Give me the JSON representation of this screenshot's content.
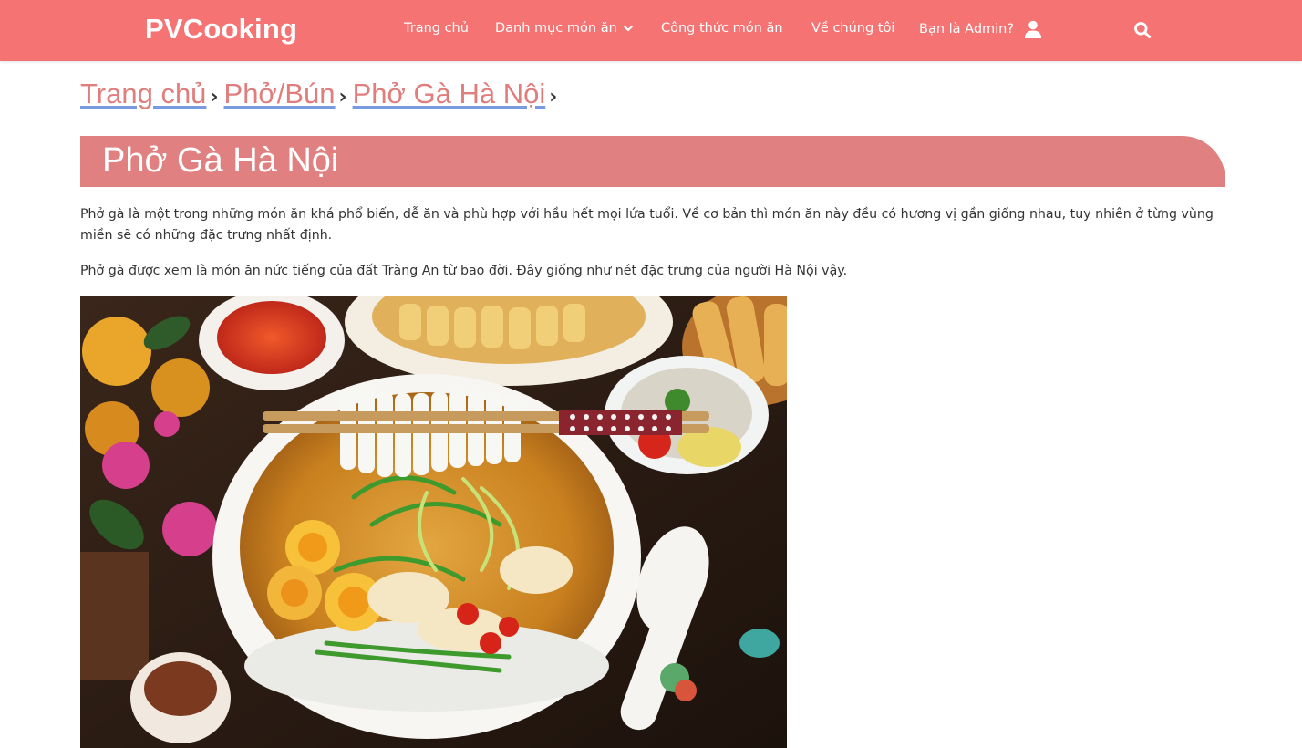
{
  "brand": "PVCooking",
  "nav": {
    "home": "Trang chủ",
    "categories": "Danh mục món ăn",
    "recipes": "Công thức món ăn",
    "about": "Về chúng tôi",
    "admin": "Bạn là Admin?"
  },
  "breadcrumb": {
    "items": [
      "Trang chủ",
      "Phở/Bún",
      "Phở Gà Hà Nội"
    ],
    "separator": "›"
  },
  "article": {
    "title": "Phở Gà Hà Nội",
    "paragraphs": [
      "Phở gà là một trong những món ăn khá phổ biến, dễ ăn và phù hợp với hầu hết mọi lứa tuổi. Về cơ bản thì món ăn này đều có hương vị gần giống nhau, tuy nhiên ở từng vùng miền sẽ có những đặc trưng nhất định.",
      "Phở gà được xem là món ăn nức tiếng của đất Tràng An từ bao đời. Đây giống như nét đặc trưng của người Hà Nội vậy."
    ]
  },
  "icons": {
    "categories_dropdown": "chevron-down-icon",
    "admin": "user-icon",
    "search": "search-icon"
  },
  "colors": {
    "navbar": "#f57373",
    "title_bar": "#e08080",
    "link": "#e07d7d"
  }
}
